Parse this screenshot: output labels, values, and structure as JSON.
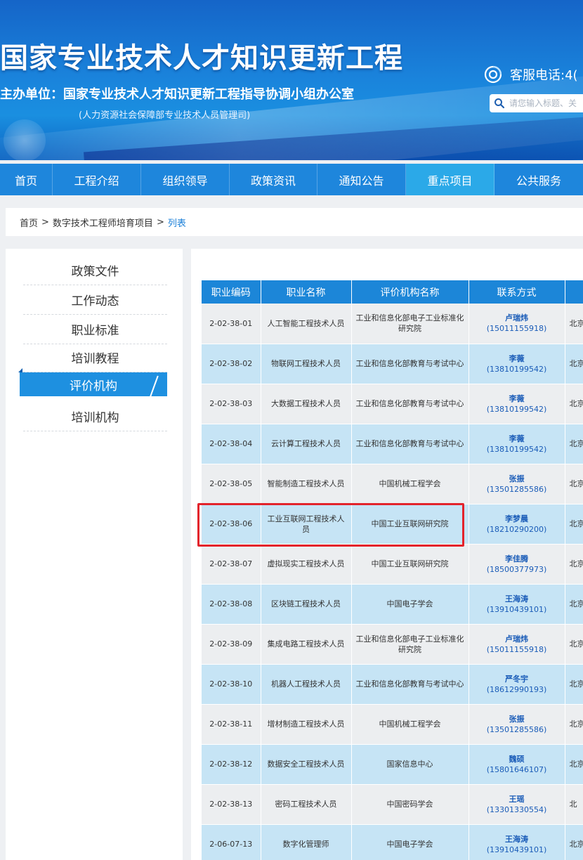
{
  "header": {
    "title": "国家专业技术人才知识更新工程",
    "sponsor_label": "主办单位：",
    "sponsor": "国家专业技术人才知识更新工程指导协调小组办公室",
    "sponsor_sub": "(人力资源社会保障部专业技术人员管理司)",
    "hotline": "客服电话:4(",
    "search_placeholder": "请您输入标题、关",
    "icons": [
      "headset-icon",
      "search-icon"
    ]
  },
  "nav": {
    "items": [
      "首页",
      "工程介绍",
      "组织领导",
      "政策资讯",
      "通知公告",
      "重点项目",
      "公共服务"
    ],
    "active": "重点项目"
  },
  "breadcrumb": {
    "home": "首页",
    "sep": ">",
    "section": "数字技术工程师培育项目",
    "current": "列表"
  },
  "sidebar": {
    "items": [
      "政策文件",
      "工作动态",
      "职业标准",
      "培训教程",
      "评价机构",
      "培训机构"
    ],
    "active": "评价机构"
  },
  "table": {
    "headers": [
      "职业编码",
      "职业名称",
      "评价机构名称",
      "联系方式",
      ""
    ],
    "rows": [
      {
        "code": "2-02-38-01",
        "name": "人工智能工程技术人员",
        "org": "工业和信息化部电子工业标准化研究院",
        "contact": "卢瑞炜",
        "phone": "(15011155918)",
        "addr": "北京"
      },
      {
        "code": "2-02-38-02",
        "name": "物联网工程技术人员",
        "org": "工业和信息化部教育与考试中心",
        "contact": "李薇",
        "phone": "(13810199542)",
        "addr": "北京"
      },
      {
        "code": "2-02-38-03",
        "name": "大数据工程技术人员",
        "org": "工业和信息化部教育与考试中心",
        "contact": "李薇",
        "phone": "(13810199542)",
        "addr": "北京"
      },
      {
        "code": "2-02-38-04",
        "name": "云计算工程技术人员",
        "org": "工业和信息化部教育与考试中心",
        "contact": "李薇",
        "phone": "(13810199542)",
        "addr": "北京"
      },
      {
        "code": "2-02-38-05",
        "name": "智能制造工程技术人员",
        "org": "中国机械工程学会",
        "contact": "张振",
        "phone": "(13501285586)",
        "addr": "北京"
      },
      {
        "code": "2-02-38-06",
        "name": "工业互联网工程技术人员",
        "org": "中国工业互联网研究院",
        "contact": "李梦晨",
        "phone": "(18210290200)",
        "addr": "北京"
      },
      {
        "code": "2-02-38-07",
        "name": "虚拟现实工程技术人员",
        "org": "中国工业互联网研究院",
        "contact": "李佳腾",
        "phone": "(18500377973)",
        "addr": "北京"
      },
      {
        "code": "2-02-38-08",
        "name": "区块链工程技术人员",
        "org": "中国电子学会",
        "contact": "王海涛",
        "phone": "(13910439101)",
        "addr": "北京"
      },
      {
        "code": "2-02-38-09",
        "name": "集成电路工程技术人员",
        "org": "工业和信息化部电子工业标准化研究院",
        "contact": "卢瑞炜",
        "phone": "(15011155918)",
        "addr": "北京"
      },
      {
        "code": "2-02-38-10",
        "name": "机器人工程技术人员",
        "org": "工业和信息化部教育与考试中心",
        "contact": "严冬宇",
        "phone": "(18612990193)",
        "addr": "北京"
      },
      {
        "code": "2-02-38-11",
        "name": "增材制造工程技术人员",
        "org": "中国机械工程学会",
        "contact": "张振",
        "phone": "(13501285586)",
        "addr": "北京"
      },
      {
        "code": "2-02-38-12",
        "name": "数据安全工程技术人员",
        "org": "国家信息中心",
        "contact": "魏硕",
        "phone": "(15801646107)",
        "addr": "北京"
      },
      {
        "code": "2-02-38-13",
        "name": "密码工程技术人员",
        "org": "中国密码学会",
        "contact": "王瑶",
        "phone": "(13301330554)",
        "addr": "北"
      },
      {
        "code": "2-06-07-13",
        "name": "数字化管理师",
        "org": "中国电子学会",
        "contact": "王海涛",
        "phone": "(13910439101)",
        "addr": "北京"
      }
    ]
  },
  "highlight_row": "2-02-38-06",
  "colors": {
    "banner": "#1a84dc",
    "nav": "#1e86dc",
    "nav_active": "#2ba9e8",
    "table_header": "#1c86d8",
    "row_even": "#c6e4f5",
    "row_odd": "#eceef0",
    "highlight_border": "#e3232b",
    "contact_text": "#1a5cb8"
  }
}
